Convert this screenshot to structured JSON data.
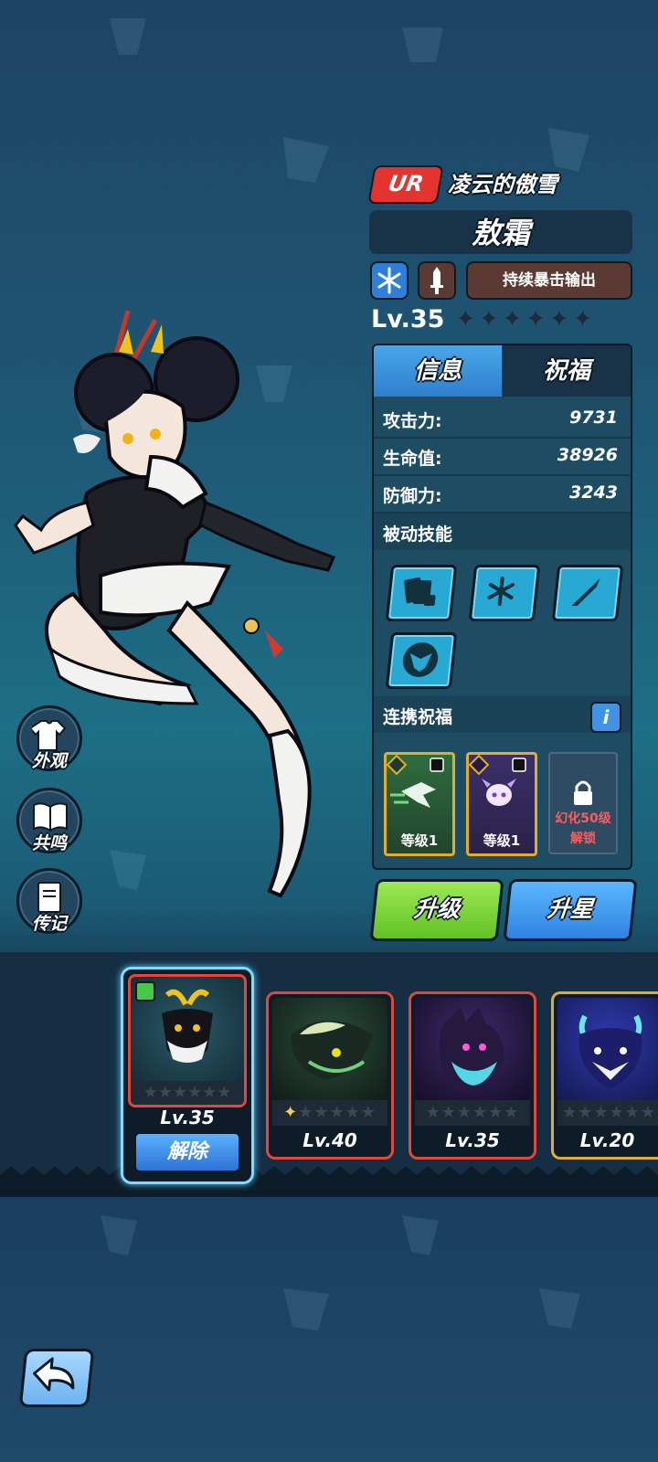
{
  "character": {
    "rarity": "UR",
    "title": "凌云的傲雪",
    "name": "敖霜",
    "role": "持续暴击输出",
    "level": "Lv.35",
    "stars_total": 6,
    "element_icon": "snowflake-icon",
    "weapon_icon": "sword-icon"
  },
  "side_menu": [
    {
      "label": "外观",
      "icon": "shirt-icon"
    },
    {
      "label": "共鸣",
      "icon": "book-icon"
    },
    {
      "label": "传记",
      "icon": "journal-icon"
    }
  ],
  "tabs": {
    "info": "信息",
    "blessing": "祝福"
  },
  "stats": [
    {
      "label": "攻击力:",
      "value": "9731"
    },
    {
      "label": "生命值:",
      "value": "38926"
    },
    {
      "label": "防御力:",
      "value": "3243"
    }
  ],
  "passive": {
    "heading": "被动技能",
    "skills": [
      "cards-dice-icon",
      "snowflakes-icon",
      "claw-slash-icon",
      "dragon-head-icon"
    ]
  },
  "link_blessing": {
    "heading": "连携祝福",
    "info_label": "i",
    "cards": [
      {
        "level": "等级1",
        "icon": "wind-spirit-icon"
      },
      {
        "level": "等级1",
        "icon": "horned-spirit-icon"
      }
    ],
    "locked_line1": "幻化50级",
    "locked_line2": "解锁"
  },
  "actions": {
    "upgrade": "升级",
    "star_up": "升星"
  },
  "pets": [
    {
      "level": "Lv.35",
      "selected": true,
      "action": "解除"
    },
    {
      "level": "Lv.40",
      "selected": false,
      "stars": 1
    },
    {
      "level": "Lv.35",
      "selected": false
    },
    {
      "level": "Lv.20",
      "selected": false
    }
  ],
  "colors": {
    "ur": "#e5332f",
    "upgrade": "#7ad53a",
    "star_up": "#3f9bf0",
    "accent": "#e3ad2c"
  }
}
